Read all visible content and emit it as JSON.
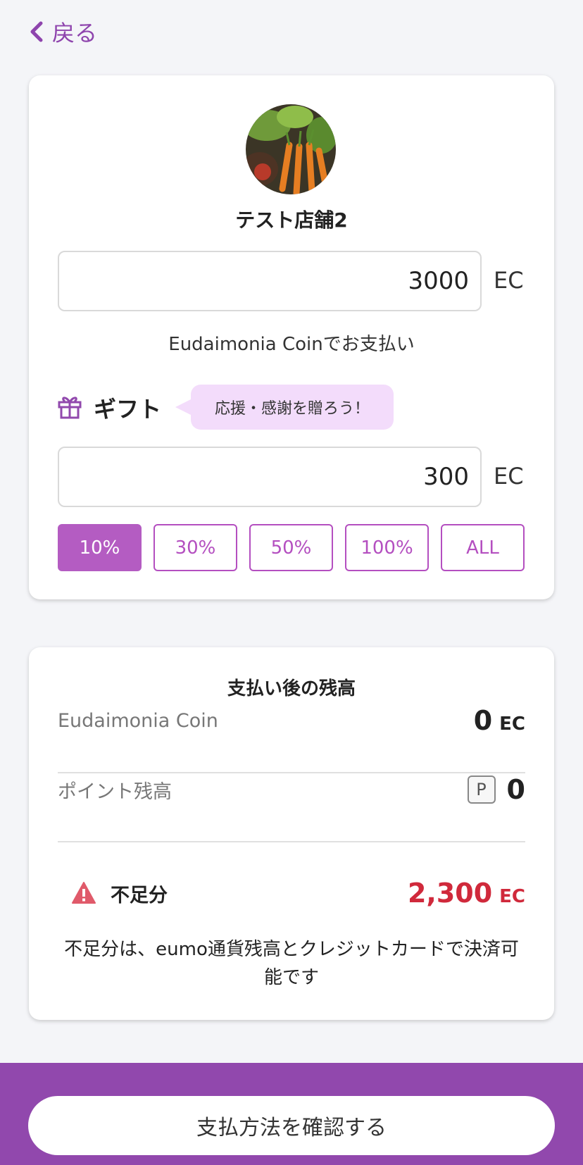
{
  "nav": {
    "back_label": "戻る"
  },
  "shop": {
    "name": "テスト店舗2"
  },
  "payment": {
    "amount": "3000",
    "unit": "EC",
    "note": "Eudaimonia Coinでお支払い"
  },
  "gift": {
    "label": "ギフト",
    "bubble": "応援・感謝を贈ろう！",
    "amount": "300",
    "unit": "EC",
    "options": [
      "10%",
      "30%",
      "50%",
      "100%",
      "ALL"
    ],
    "selected": "10%"
  },
  "balance": {
    "title": "支払い後の残高",
    "coin_label": "Eudaimonia Coin",
    "coin_value": "0",
    "coin_unit": "EC",
    "point_label": "ポイント残高",
    "point_badge": "P",
    "point_value": "0",
    "shortage_label": "不足分",
    "shortage_value": "2,300",
    "shortage_unit": "EC",
    "note": "不足分は、eumo通貨残高とクレジットカードで決済可能です"
  },
  "footer": {
    "confirm_label": "支払方法を確認する"
  },
  "colors": {
    "accent": "#9148ad",
    "button": "#b44fc0",
    "warning": "#d0293b",
    "bubble": "#f3dcfb"
  }
}
